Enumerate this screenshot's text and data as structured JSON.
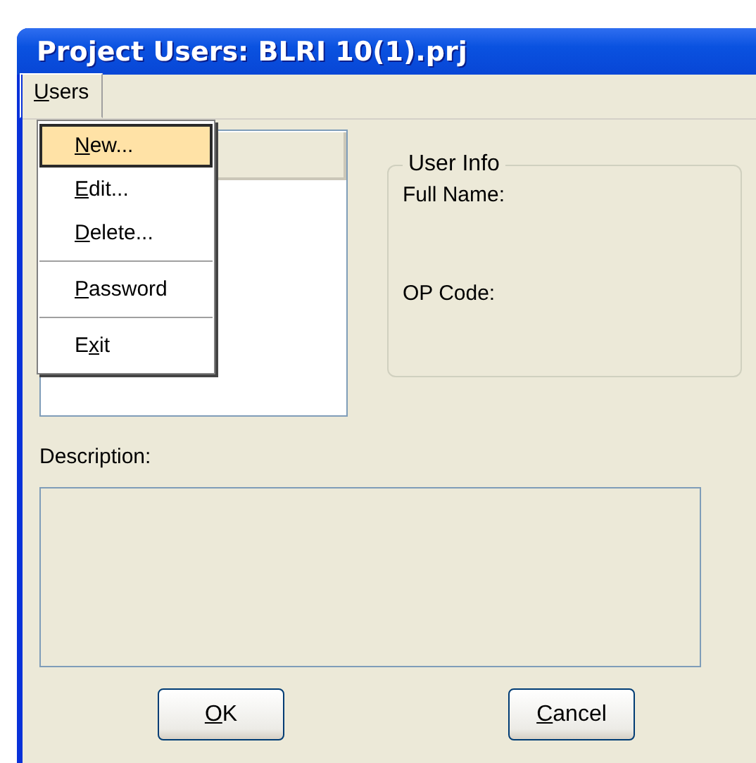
{
  "window": {
    "title": "Project Users: BLRI 10(1).prj"
  },
  "menu_bar": [
    {
      "key": "U",
      "rest": "sers",
      "open": true
    }
  ],
  "menu": {
    "items": [
      {
        "kind": "item",
        "key": "N",
        "rest": "ew...",
        "selected": true
      },
      {
        "kind": "item",
        "key": "E",
        "rest": "dit...",
        "selected": false
      },
      {
        "kind": "item",
        "key": "D",
        "rest": "elete...",
        "selected": false
      },
      {
        "kind": "separator"
      },
      {
        "kind": "item",
        "key": "P",
        "rest": "assword",
        "selected": false
      },
      {
        "kind": "separator"
      },
      {
        "kind": "item",
        "lead": "E",
        "key": "x",
        "rest": "it",
        "selected": false
      }
    ]
  },
  "user_info": {
    "title": "User Info",
    "fields": [
      "Full Name:",
      "OP Code:"
    ]
  },
  "description": {
    "label": "Description:"
  },
  "buttons": [
    {
      "key": "O",
      "rest": "K"
    },
    {
      "key": "C",
      "rest": "ancel"
    }
  ]
}
